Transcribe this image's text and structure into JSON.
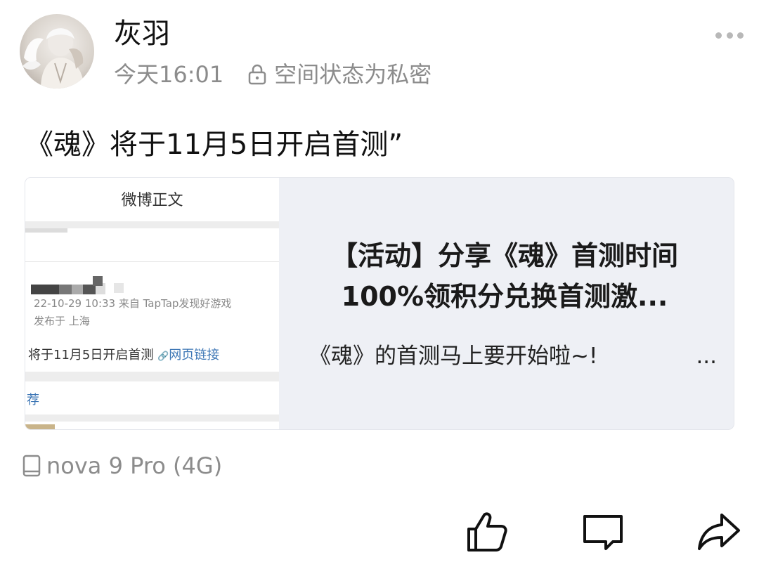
{
  "post": {
    "username": "灰羽",
    "time": "今天16:01",
    "privacy": "空间状态为私密",
    "text": "《魂》将于11月5日开启首测”",
    "device": "nova 9 Pro (4G)"
  },
  "card": {
    "title": "【活动】分享《魂》首测时间 100%领积分兑换首测激...",
    "description": "《魂》的首测马上要开始啦~!",
    "description_ellipsis": "...",
    "thumbnail": {
      "header": "微博正文",
      "date_line": "22-10-29 10:33  来自 TapTap发现好游戏",
      "location_line": "发布于 上海",
      "body_text": "将于11月5日开启首测",
      "link_text": "网页链接",
      "link_icon": "🔗",
      "section_label": "荐"
    }
  },
  "icons": {
    "more": "more-icon",
    "lock": "lock-icon",
    "device": "phone-icon",
    "like": "thumbs-up-icon",
    "comment": "comment-icon",
    "share": "share-icon"
  },
  "colors": {
    "meta_gray": "#8c8c8c",
    "card_background": "#eef0f5",
    "link_blue": "#3c76b5"
  }
}
